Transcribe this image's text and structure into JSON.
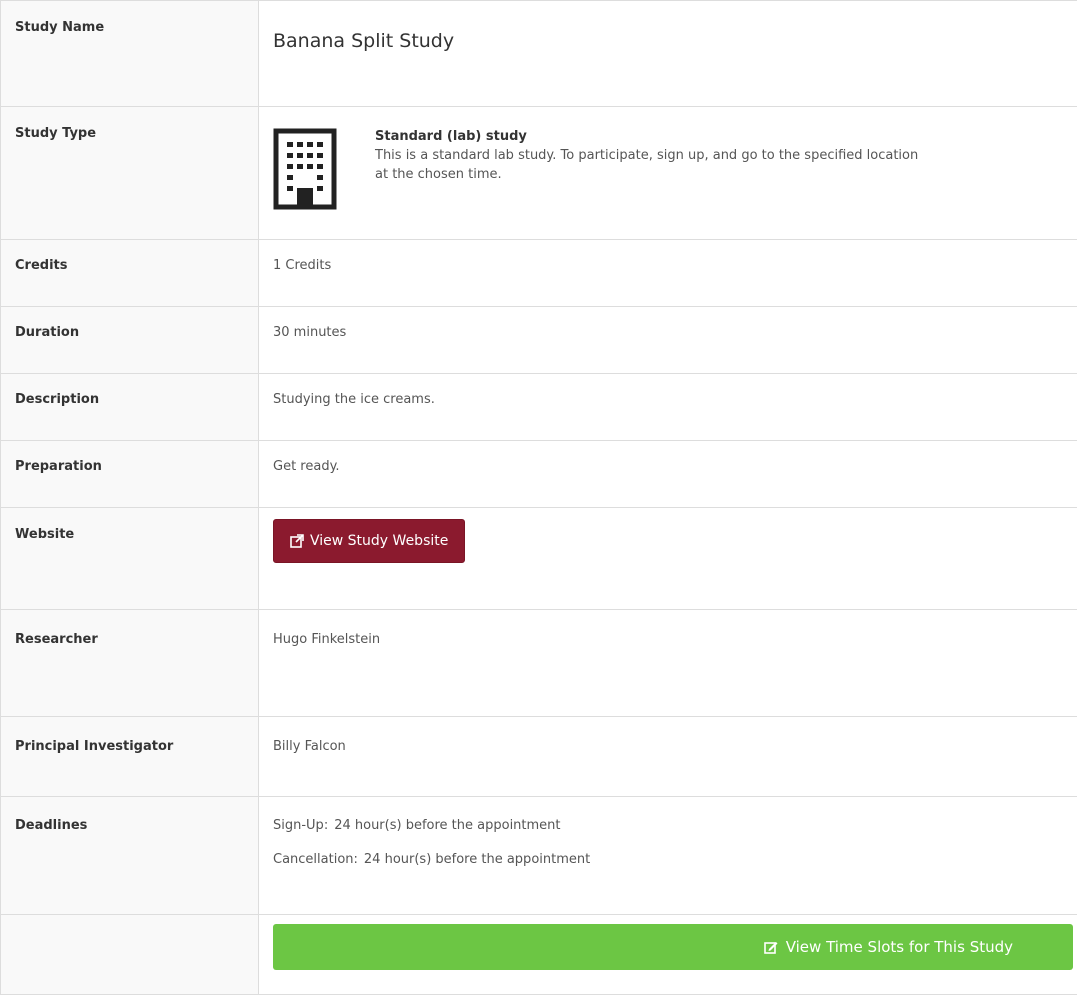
{
  "rows": {
    "study_name": {
      "label": "Study Name",
      "value": "Banana Split Study"
    },
    "study_type": {
      "label": "Study Type",
      "title": "Standard (lab) study",
      "description": "This is a standard lab study. To participate, sign up, and go to the specified location at the chosen time.",
      "icon": "building-icon"
    },
    "credits": {
      "label": "Credits",
      "value": "1 Credits"
    },
    "duration": {
      "label": "Duration",
      "value": "30 minutes"
    },
    "description": {
      "label": "Description",
      "value": "Studying the ice creams."
    },
    "preparation": {
      "label": "Preparation",
      "value": "Get ready."
    },
    "website": {
      "label": "Website",
      "button_label": "View Study Website",
      "icon": "external-link-icon",
      "color": "#8b1a2e"
    },
    "researcher": {
      "label": "Researcher",
      "value": "Hugo Finkelstein"
    },
    "pi": {
      "label": "Principal Investigator",
      "value": "Billy Falcon"
    },
    "deadlines": {
      "label": "Deadlines",
      "signup_key": "Sign-Up:",
      "signup_value": "24 hour(s) before the appointment",
      "cancel_key": "Cancellation:",
      "cancel_value": "24 hour(s) before the appointment"
    },
    "actions": {
      "button_label": "View Time Slots for This Study",
      "icon": "edit-icon",
      "color": "#6cc644"
    }
  }
}
